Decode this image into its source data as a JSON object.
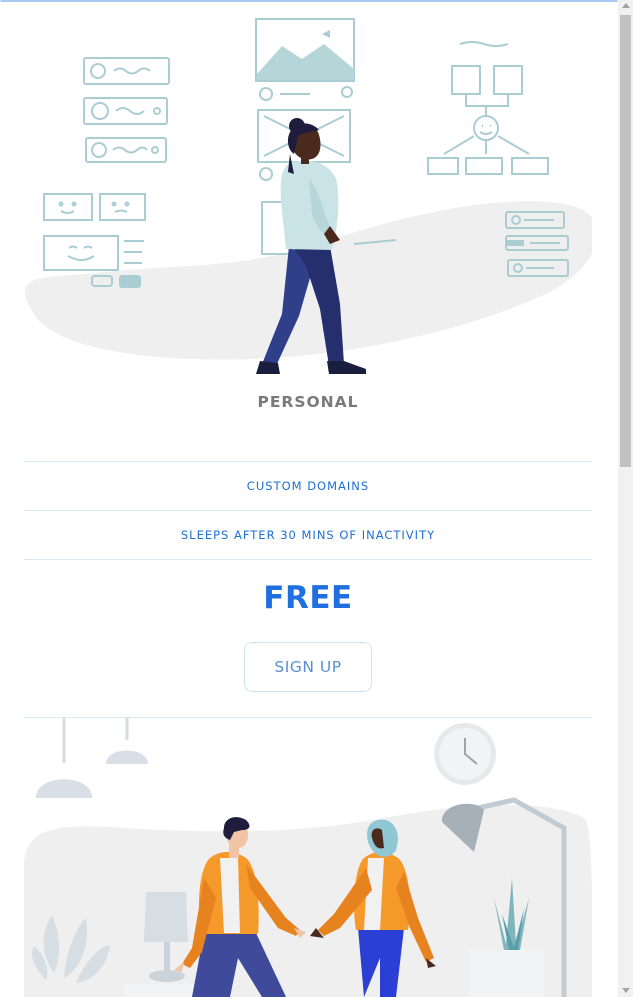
{
  "plan": {
    "name": "PERSONAL",
    "features": [
      "CUSTOM DOMAINS",
      "SLEEPS AFTER 30 MINS OF INACTIVITY"
    ],
    "price": "FREE",
    "cta_label": "SIGN UP"
  },
  "colors": {
    "accent": "#1f6fe0",
    "feature_text": "#1e6fd4",
    "plan_name": "#7a7a7a",
    "border": "#d9e9f7"
  },
  "illustrations": {
    "top": "woman-walking-with-wireframes",
    "bottom": "two-people-meeting-in-room"
  }
}
